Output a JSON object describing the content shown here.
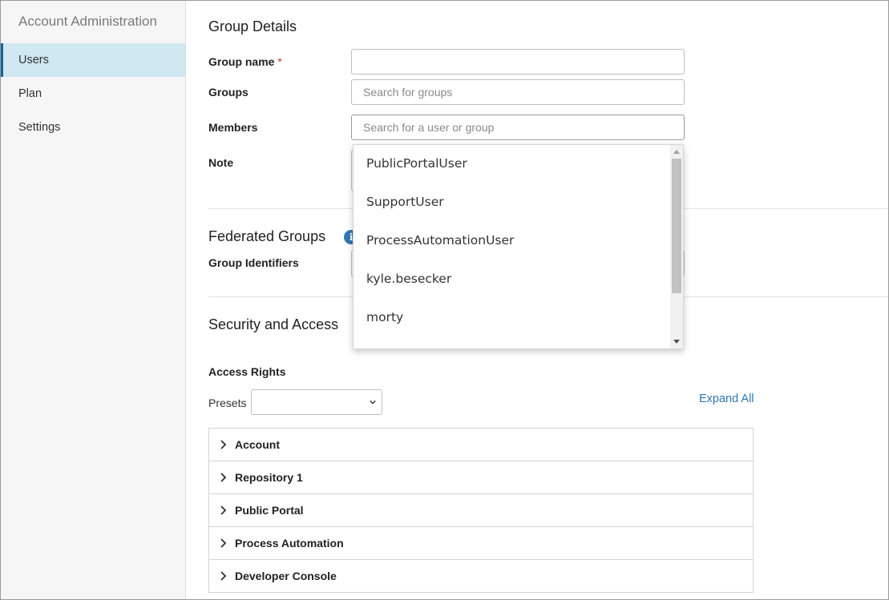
{
  "sidebar": {
    "title": "Account Administration",
    "items": [
      {
        "label": "Users",
        "active": true
      },
      {
        "label": "Plan",
        "active": false
      },
      {
        "label": "Settings",
        "active": false
      }
    ]
  },
  "group_details": {
    "title": "Group Details",
    "group_name_label": "Group name",
    "required_mark": "*",
    "group_name_value": "",
    "groups_label": "Groups",
    "groups_placeholder": "Search for groups",
    "members_label": "Members",
    "members_placeholder": "Search for a user or group",
    "note_label": "Note"
  },
  "members_dropdown": {
    "options": [
      "PublicPortalUser",
      "SupportUser",
      "ProcessAutomationUser",
      "kyle.besecker",
      "morty"
    ]
  },
  "federated": {
    "title": "Federated Groups",
    "info_icon": "info-icon",
    "group_identifiers_label": "Group Identifiers"
  },
  "security": {
    "title": "Security and Access",
    "access_rights_label": "Access Rights",
    "presets_label": "Presets",
    "presets_value": "",
    "expand_all": "Expand All",
    "sections": [
      "Account",
      "Repository 1",
      "Public Portal",
      "Process Automation",
      "Developer Console"
    ]
  },
  "colors": {
    "accent": "#2f77b3",
    "active_nav_bg": "#cfe8f2",
    "required": "#c0392b"
  }
}
